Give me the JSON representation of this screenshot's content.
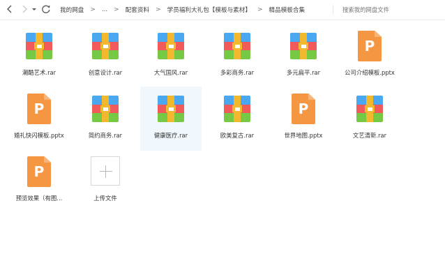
{
  "toolbar": {
    "back_icon": "chevron-left-icon",
    "forward_icon": "chevron-right-icon",
    "history_icon": "caret-down-icon",
    "refresh_icon": "refresh-icon",
    "breadcrumbs": [
      "我的网盘",
      "...",
      "配套资料",
      "学员福利大礼包【模板与素材】",
      "精品模板合集"
    ],
    "separator": ">",
    "search_placeholder": "搜索我的网盘文件"
  },
  "files": [
    {
      "name": "潮酷艺术.rar",
      "type": "rar"
    },
    {
      "name": "创意设计.rar",
      "type": "rar"
    },
    {
      "name": "大气国风.rar",
      "type": "rar"
    },
    {
      "name": "多彩商务.rar",
      "type": "rar"
    },
    {
      "name": "多元扁平.rar",
      "type": "rar"
    },
    {
      "name": "公司介绍模板.pptx",
      "type": "pptx"
    },
    {
      "name": "婚礼快闪模板.pptx",
      "type": "pptx"
    },
    {
      "name": "简约商务.rar",
      "type": "rar"
    },
    {
      "name": "健康医疗.rar",
      "type": "rar",
      "selected": true
    },
    {
      "name": "欧美复古.rar",
      "type": "rar"
    },
    {
      "name": "世界地图.pptx",
      "type": "pptx"
    },
    {
      "name": "文艺清新.rar",
      "type": "rar"
    },
    {
      "name": "预览效果（有图...",
      "type": "pptx"
    }
  ],
  "upload": {
    "label": "上传文件",
    "icon": "plus-icon"
  },
  "colors": {
    "archive_blue": "#4aa8f0",
    "archive_red": "#f05a5a",
    "archive_green": "#76c944",
    "archive_strap": "#f2b92e",
    "pptx_orange": "#f59643",
    "selected_bg": "#f1f8fd"
  }
}
